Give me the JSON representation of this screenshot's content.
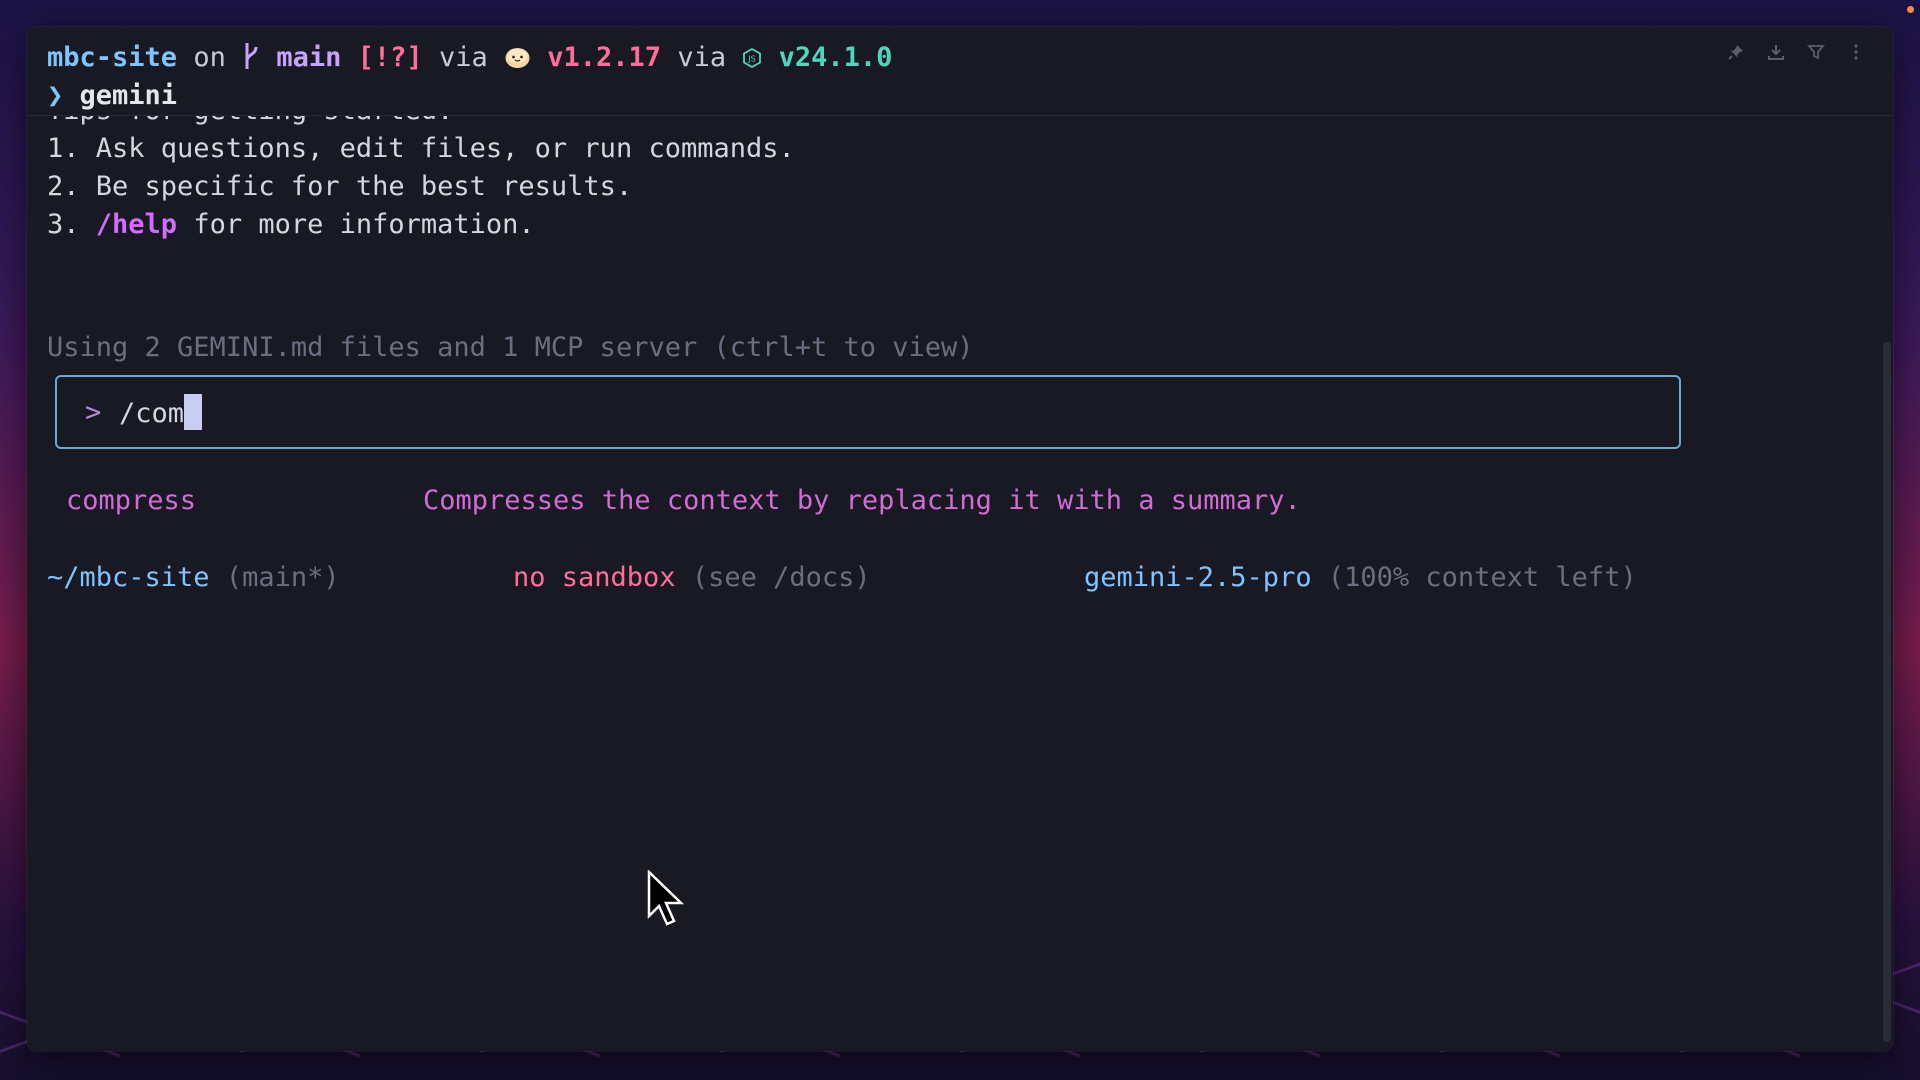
{
  "prompt": {
    "dir": "mbc-site",
    "on": "on",
    "branch": "main",
    "status": "[!?]",
    "via1": "via",
    "bun_version": "v1.2.17",
    "via2": "via",
    "node_version": "v24.1.0",
    "arrow": "❯",
    "command": "gemini"
  },
  "tips": {
    "partial_heading": "Tips for getting started:",
    "item1": "1. Ask questions, edit files, or run commands.",
    "item2": "2. Be specific for the best results.",
    "item3_num": "3. ",
    "item3_cmd": "/help",
    "item3_rest": " for more information."
  },
  "context_info": "Using 2 GEMINI.md files and 1 MCP server (ctrl+t to view)",
  "input": {
    "prompt_symbol": ">",
    "value": "/com"
  },
  "suggestion": {
    "command": "compress",
    "description": "Compresses the context by replacing it with a summary."
  },
  "footer": {
    "path": "~/mbc-site",
    "branch": "(main*)",
    "sandbox": "no sandbox",
    "sandbox_hint": "(see /docs)",
    "model": "gemini-2.5-pro",
    "context": "(100% context left)"
  },
  "toolbar_icons": [
    "pin-icon",
    "download-icon",
    "filter-icon",
    "more-vertical-icon"
  ],
  "colors": {
    "window_bg": "#181922",
    "accent_blue": "#7fc3ff",
    "accent_pink": "#ff6e9a",
    "accent_purple": "#d36bff",
    "accent_teal": "#4fd6be",
    "dim": "#6b6e80"
  }
}
